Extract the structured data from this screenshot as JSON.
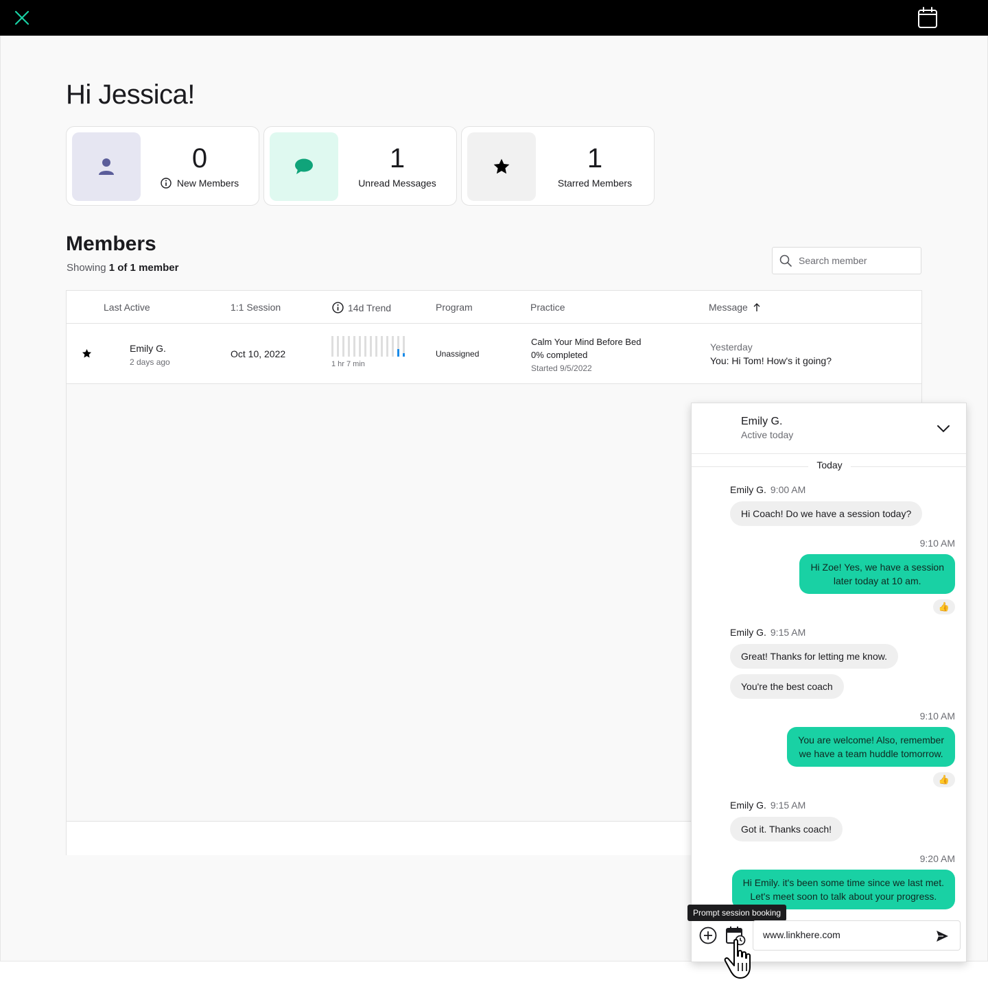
{
  "header": {
    "close_icon": "close-icon",
    "calendar_icon": "calendar-icon"
  },
  "greeting": "Hi Jessica!",
  "stats": [
    {
      "value": "0",
      "label": "New Members",
      "icon": "person-icon",
      "has_info": true,
      "color": "#e6e6f2"
    },
    {
      "value": "1",
      "label": "Unread Messages",
      "icon": "chat-bubble-icon",
      "color": "#dff9f0"
    },
    {
      "value": "1",
      "label": "Starred Members",
      "icon": "star-icon",
      "color": "#f1f1f1"
    }
  ],
  "members": {
    "title": "Members",
    "showing_prefix": "Showing",
    "showing_count": "1 of 1 member",
    "search_placeholder": "Search member"
  },
  "table": {
    "headers": {
      "last_active": "Last Active",
      "session": "1:1 Session",
      "trend": "14d Trend",
      "program": "Program",
      "practice": "Practice",
      "message": "Message"
    },
    "rows": [
      {
        "starred": true,
        "name": "Emily G.",
        "last_active": "2 days ago",
        "session": "Oct 10, 2022",
        "trend": [
          0,
          0,
          0,
          0,
          0,
          0,
          0,
          0,
          0,
          0,
          0,
          0,
          0.35,
          0.15
        ],
        "trend_caption": "1 hr 7 min",
        "program": "Unassigned",
        "practice_title": "Calm Your Mind Before Bed",
        "practice_progress": "0% completed",
        "practice_started": "Started 9/5/2022",
        "message_when": "Yesterday",
        "message_text": "You: Hi Tom! How's it going?"
      }
    ]
  },
  "chat": {
    "name": "Emily G.",
    "status": "Active today",
    "day": "Today",
    "messages": [
      {
        "from": "Emily G.",
        "time": "9:00 AM",
        "text": "Hi Coach! Do we have a session today?"
      },
      {
        "time": "9:10 AM",
        "lines": [
          "Hi Zoe! Yes, we have a session",
          "later today at 10 am."
        ],
        "reaction": "👍"
      },
      {
        "from": "Emily G.",
        "time": "9:15 AM",
        "texts": [
          "Great! Thanks for letting me know.",
          "You're the best coach"
        ]
      },
      {
        "time": "9:10 AM",
        "lines": [
          "You are welcome! Also, remember",
          "we have a team huddle tomorrow."
        ],
        "reaction": "👍"
      },
      {
        "from": "Emily G.",
        "time": "9:15 AM",
        "text": "Got it. Thanks coach!"
      },
      {
        "time": "9:20 AM",
        "lines": [
          "Hi Emily. it's been some time since we last met.",
          "Let's meet soon to talk about your progress."
        ]
      }
    ],
    "tooltip": "Prompt session booking",
    "composer_value": "www.linkhere.com"
  },
  "colors": {
    "accent": "#19d1a4",
    "topbar": "#000000",
    "trend_active": "#1a8be8"
  }
}
